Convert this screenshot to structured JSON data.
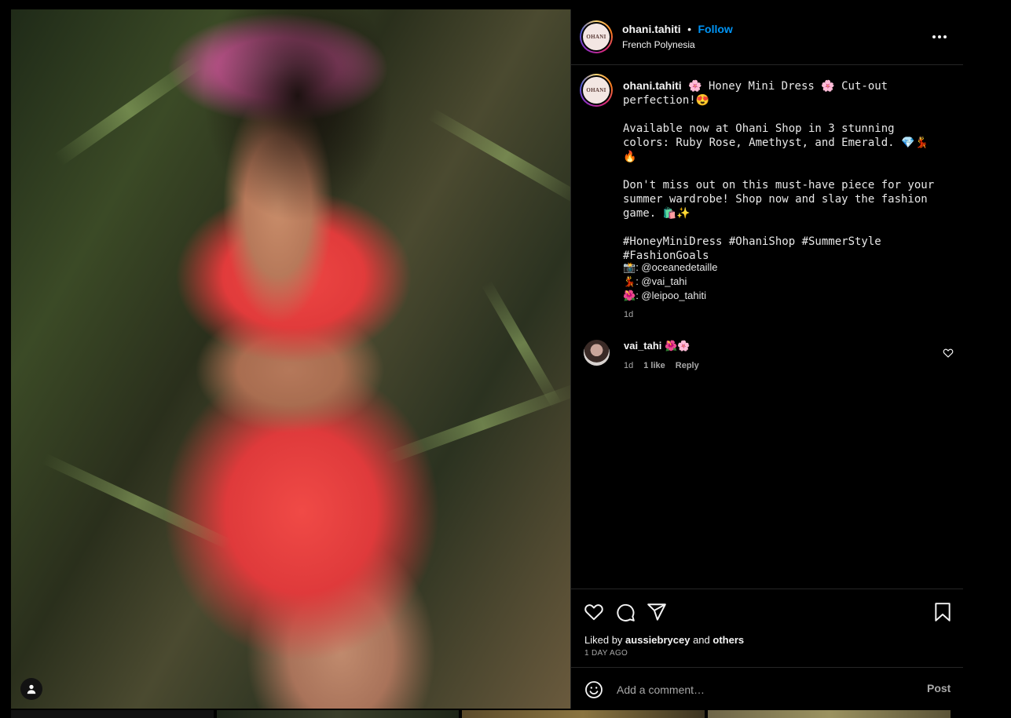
{
  "post": {
    "image_alt": "Woman in red floral halter mini dress with pink flower crown in a tropical forest"
  },
  "header": {
    "username": "ohani.tahiti",
    "separator": "•",
    "follow_label": "Follow",
    "location": "French Polynesia",
    "avatar_text": "OHANI"
  },
  "caption": {
    "username": "ohani.tahiti",
    "line1": " 🌸 Honey Mini Dress 🌸 Cut-out perfection!😍",
    "paragraph2": "Available now at Ohani Shop in 3 stunning colors: Ruby Rose, Amethyst, and Emerald. 💎💃🔥",
    "paragraph3": "Don't miss out on this must-have piece for your summer wardrobe! Shop now and slay the fashion game. 🛍️✨",
    "hashtags": "#HoneyMiniDress #OhaniShop #SummerStyle #FashionGoals",
    "credits": [
      {
        "emoji": "📸",
        "handle": "@oceanedetaille"
      },
      {
        "emoji": "💃",
        "handle": "@vai_tahi"
      },
      {
        "emoji": "🌺",
        "handle": "@leipoo_tahiti"
      }
    ],
    "time": "1d"
  },
  "comments": [
    {
      "username": "vai_tahi",
      "text": " 🌺🌸",
      "time": "1d",
      "likes": "1 like",
      "reply_label": "Reply"
    }
  ],
  "actions": {
    "liked_by_prefix": "Liked by ",
    "liked_by_user": "aussiebrycey",
    "liked_by_and": " and ",
    "liked_by_others": "others",
    "time_ago": "1 DAY AGO"
  },
  "comment_box": {
    "placeholder": "Add a comment…",
    "post_label": "Post"
  },
  "colors": {
    "background": "#000000",
    "text": "#f5f5f5",
    "muted": "#a8a8a8",
    "link_blue": "#0095f6",
    "border": "#262626"
  },
  "icons": [
    "user-icon",
    "more-options-icon",
    "heart-icon",
    "comment-icon",
    "share-icon",
    "bookmark-icon",
    "emoji-icon"
  ]
}
